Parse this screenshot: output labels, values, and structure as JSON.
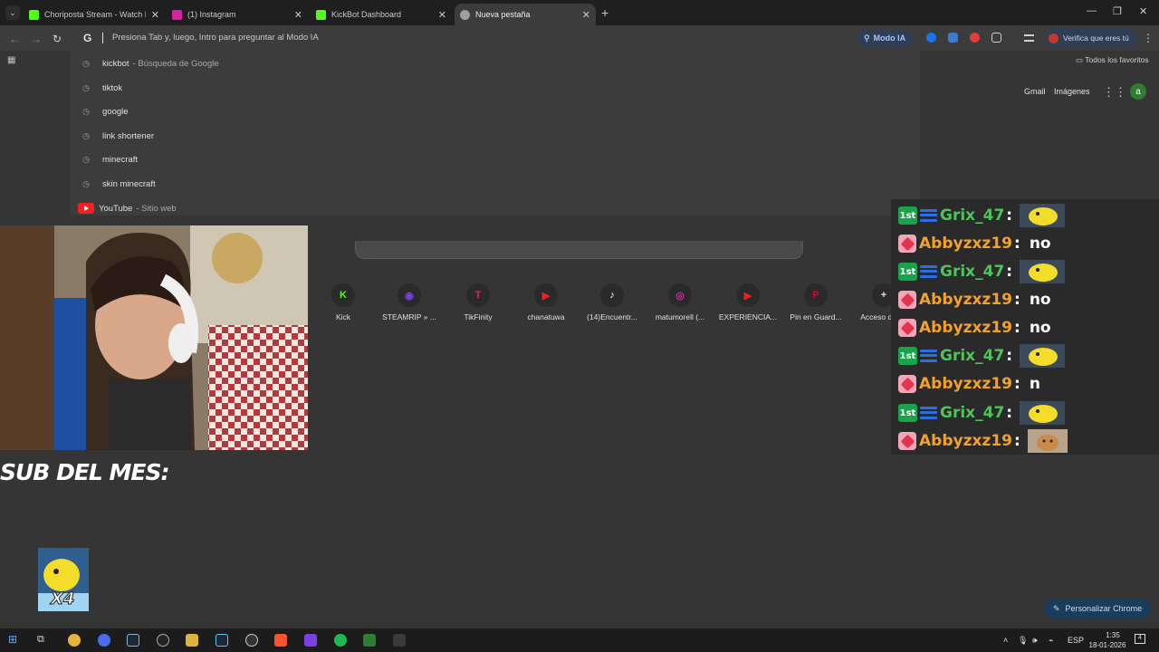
{
  "tabs": [
    {
      "title": "Choriposta Stream - Watch Live",
      "favicon_color": "#53fc18"
    },
    {
      "title": "(1) Instagram",
      "favicon_color": "#d6249f"
    },
    {
      "title": "KickBot Dashboard",
      "favicon_color": "#53fc18"
    },
    {
      "title": "Nueva pestaña",
      "favicon_color": "#9aa0a6"
    }
  ],
  "omnibox": {
    "placeholder": "Presiona Tab y, luego, Intro para preguntar al Modo IA",
    "mode_button": "Modo IA"
  },
  "profile_button": "Verifica que eres tú",
  "bookmarks": {
    "all_label": "Todos los favoritos"
  },
  "suggestions": [
    {
      "text": "kickbot",
      "sub": "- Búsqueda de Google",
      "icon": "history-icon"
    },
    {
      "text": "tiktok",
      "sub": "",
      "icon": "history-icon"
    },
    {
      "text": "google",
      "sub": "",
      "icon": "history-icon"
    },
    {
      "text": "link shortener",
      "sub": "",
      "icon": "history-icon"
    },
    {
      "text": "minecraft",
      "sub": "",
      "icon": "history-icon"
    },
    {
      "text": "skin minecraft",
      "sub": "",
      "icon": "history-icon"
    },
    {
      "text": "YouTube",
      "sub": "- Sitio web",
      "icon": "youtube-icon"
    }
  ],
  "header_links": {
    "gmail": "Gmail",
    "images": "Imágenes",
    "avatar_letter": "a"
  },
  "shortcuts": [
    {
      "label": "Kick",
      "glyph": "K",
      "color": "#53fc18"
    },
    {
      "label": "STEAMRIP » ...",
      "glyph": "◉",
      "color": "#7b3fe4"
    },
    {
      "label": "TikFinity",
      "glyph": "T",
      "color": "#e0245e"
    },
    {
      "label": "chanatuwa",
      "glyph": "▶",
      "color": "#e22"
    },
    {
      "label": "(14)Encuentr...",
      "glyph": "♪",
      "color": "#ffffff"
    },
    {
      "label": "matumorell (...",
      "glyph": "◎",
      "color": "#d6249f"
    },
    {
      "label": "EXPERIENCIA...",
      "glyph": "▶",
      "color": "#e22"
    },
    {
      "label": "Pin en Guard...",
      "glyph": "P",
      "color": "#e60023"
    },
    {
      "label": "Acceso dire...",
      "glyph": "+",
      "color": "#e0e0e0"
    }
  ],
  "personalize_label": "Personalizar Chrome",
  "overlay": {
    "sub_title": "SUB DEL MES:",
    "sub_multiplier": "X4"
  },
  "chat": [
    {
      "user": "Grix_47",
      "badge": "first",
      "message": "",
      "emote": true
    },
    {
      "user": "Abbyzxz19",
      "badge": "gem",
      "message": "no",
      "emote": false
    },
    {
      "user": "Grix_47",
      "badge": "first",
      "message": "",
      "emote": true
    },
    {
      "user": "Abbyzxz19",
      "badge": "gem",
      "message": "no",
      "emote": false
    },
    {
      "user": "Abbyzxz19",
      "badge": "gem",
      "message": "no",
      "emote": false
    },
    {
      "user": "Grix_47",
      "badge": "first",
      "message": "",
      "emote": true
    },
    {
      "user": "Abbyzxz19",
      "badge": "gem",
      "message": "n",
      "emote": false
    },
    {
      "user": "Grix_47",
      "badge": "first",
      "message": "",
      "emote": true
    },
    {
      "user": "Abbyzxz19",
      "badge": "gem",
      "message": "",
      "emote": "dog"
    }
  ],
  "taskbar": {
    "lang": "ESP",
    "time": "1:35",
    "date": "18-01-2026",
    "notifications": "4"
  },
  "colors": {
    "accent": "#a8c7fa",
    "grix": "#4ec35c",
    "abby": "#f2a12d"
  }
}
